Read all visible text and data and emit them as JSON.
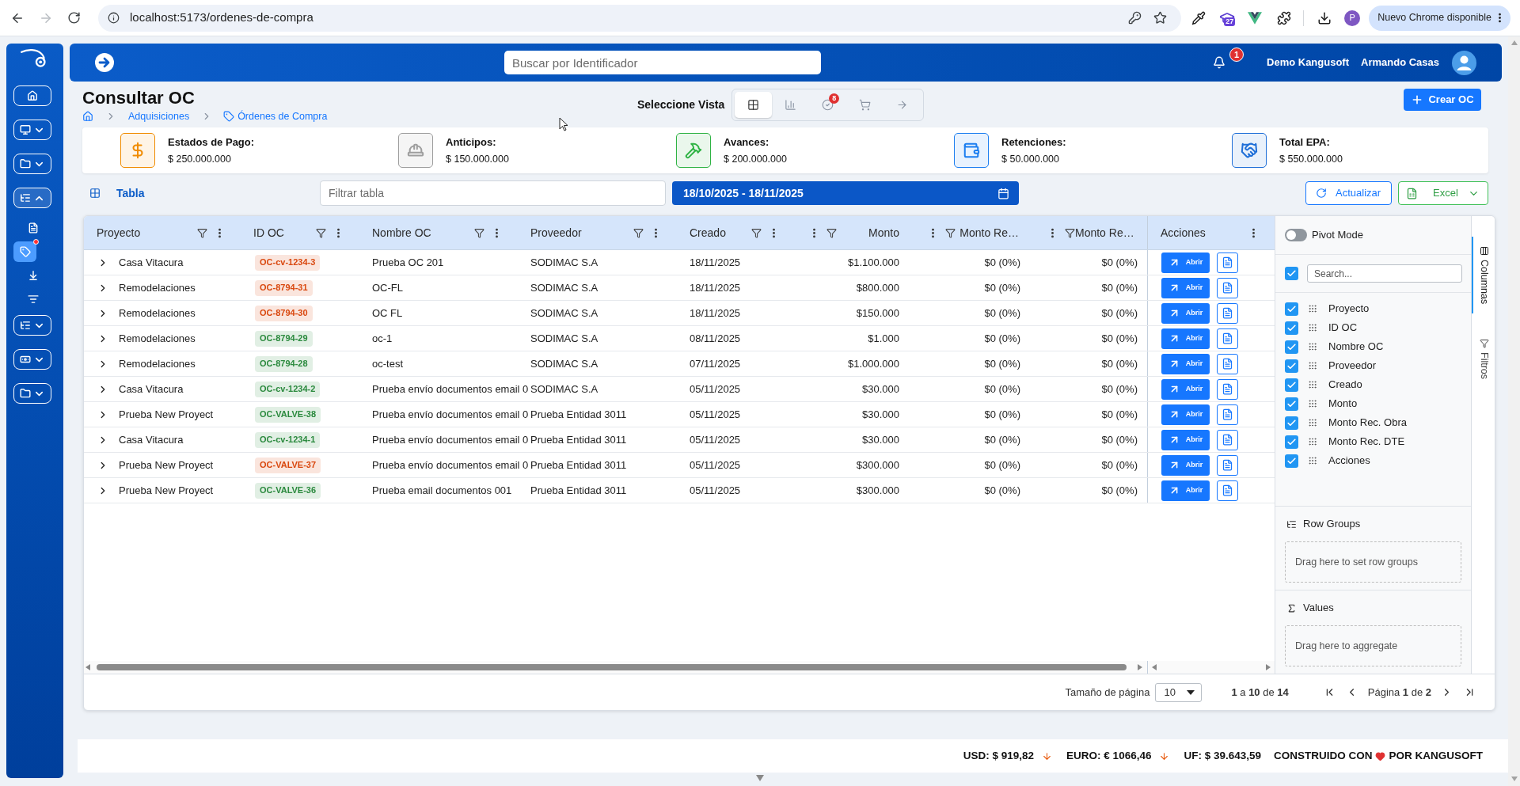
{
  "browser": {
    "forward_disabled": true,
    "url": "localhost:5173/ordenes-de-compra",
    "extension_badge": "27",
    "profile_initial": "P",
    "update_button": "Nuevo Chrome disponible"
  },
  "sidebar": {
    "items": [
      {
        "kind": "button"
      },
      {
        "kind": "dropdown",
        "expanded": false
      },
      {
        "kind": "dropdown",
        "expanded": false
      },
      {
        "kind": "dropdown",
        "expanded": true,
        "children": [
          {
            "selected": false,
            "notification": false
          },
          {
            "selected": true,
            "notification": true
          },
          {
            "selected": false,
            "notification": false
          },
          {
            "selected": false,
            "notification": false
          }
        ]
      },
      {
        "kind": "dropdown",
        "expanded": false
      },
      {
        "kind": "dropdown",
        "expanded": false
      },
      {
        "kind": "dropdown",
        "expanded": false
      }
    ]
  },
  "header": {
    "search": {
      "placeholder": "Buscar por Identificador"
    },
    "notification_count": "1",
    "company": "Demo Kangusoft",
    "user": "Armando Casas"
  },
  "page": {
    "title": "Consultar OC",
    "breadcrumbs": [
      "Adquisiciones",
      "Órdenes de Compra"
    ],
    "view_selector": {
      "label": "Seleccione Vista",
      "views": [
        {
          "selected": true
        },
        {
          "selected": false
        },
        {
          "selected": false,
          "badge": "8"
        },
        {
          "selected": false
        },
        {
          "selected": false
        }
      ]
    },
    "create_button": "Crear OC"
  },
  "summary_cards": [
    {
      "title": "Estados de Pago:",
      "value": "$ 250.000.000",
      "color": "#f08c00"
    },
    {
      "title": "Anticipos:",
      "value": "$ 150.000.000",
      "color": "#9e9e9e"
    },
    {
      "title": "Avances:",
      "value": "$ 200.000.000",
      "color": "#2fb344"
    },
    {
      "title": "Retenciones:",
      "value": "$ 50.000.000",
      "color": "#1c7ef0"
    },
    {
      "title": "Total EPA:",
      "value": "$ 550.000.000",
      "color": "#1f6fd8"
    }
  ],
  "toolbar": {
    "view_label": "Tabla",
    "filter": {
      "placeholder": "Filtrar tabla"
    },
    "date_range": "18/10/2025 - 18/11/2025",
    "refresh_button": "Actualizar",
    "export_button": "Excel"
  },
  "table": {
    "columns": [
      {
        "label": "Proyecto",
        "kind": "text",
        "filterable": true
      },
      {
        "label": "ID OC",
        "kind": "text",
        "filterable": true
      },
      {
        "label": "Nombre OC",
        "kind": "text",
        "filterable": true
      },
      {
        "label": "Proveedor",
        "kind": "text",
        "filterable": true
      },
      {
        "label": "Creado",
        "kind": "text",
        "filterable": true
      },
      {
        "label": "Monto",
        "kind": "number",
        "filterable": true
      },
      {
        "label": "Monto Re…",
        "kind": "number",
        "filterable": true
      },
      {
        "label": "Monto Re…",
        "kind": "number",
        "filterable": true
      },
      {
        "label": "Acciones",
        "kind": "actions",
        "filterable": false
      }
    ],
    "rows": [
      {
        "expanded": false,
        "project": "Casa Vitacura",
        "id": {
          "text": "OC-cv-1234-3",
          "color": "#d9480f"
        },
        "name": "Prueba OC 201",
        "supplier": "SODIMAC S.A",
        "created": "18/11/2025",
        "amount": "$1.100.000",
        "monto_rec_obra": "$0 (0%)",
        "monto_rec_dte": "$0 (0%)",
        "action": "Abrir"
      },
      {
        "expanded": false,
        "project": "Remodelaciones",
        "id": {
          "text": "OC-8794-31",
          "color": "#d9480f"
        },
        "name": "OC-FL",
        "supplier": "SODIMAC S.A",
        "created": "18/11/2025",
        "amount": "$800.000",
        "monto_rec_obra": "$0 (0%)",
        "monto_rec_dte": "$0 (0%)",
        "action": "Abrir"
      },
      {
        "expanded": false,
        "project": "Remodelaciones",
        "id": {
          "text": "OC-8794-30",
          "color": "#d9480f"
        },
        "name": "OC FL",
        "supplier": "SODIMAC S.A",
        "created": "18/11/2025",
        "amount": "$150.000",
        "monto_rec_obra": "$0 (0%)",
        "monto_rec_dte": "$0 (0%)",
        "action": "Abrir"
      },
      {
        "expanded": false,
        "project": "Remodelaciones",
        "id": {
          "text": "OC-8794-29",
          "color": "#2b8a3e"
        },
        "name": "oc-1",
        "supplier": "SODIMAC S.A",
        "created": "08/11/2025",
        "amount": "$1.000",
        "monto_rec_obra": "$0 (0%)",
        "monto_rec_dte": "$0 (0%)",
        "action": "Abrir"
      },
      {
        "expanded": false,
        "project": "Remodelaciones",
        "id": {
          "text": "OC-8794-28",
          "color": "#2b8a3e"
        },
        "name": "oc-test",
        "supplier": "SODIMAC S.A",
        "created": "07/11/2025",
        "amount": "$1.000.000",
        "monto_rec_obra": "$0 (0%)",
        "monto_rec_dte": "$0 (0%)",
        "action": "Abrir"
      },
      {
        "expanded": false,
        "project": "Casa Vitacura",
        "id": {
          "text": "OC-cv-1234-2",
          "color": "#2b8a3e"
        },
        "name": "Prueba envío documentos email 0",
        "supplier": "SODIMAC S.A",
        "created": "05/11/2025",
        "amount": "$30.000",
        "monto_rec_obra": "$0 (0%)",
        "monto_rec_dte": "$0 (0%)",
        "action": "Abrir"
      },
      {
        "expanded": false,
        "project": "Prueba New Proyect",
        "id": {
          "text": "OC-VALVE-38",
          "color": "#2b8a3e"
        },
        "name": "Prueba envío documentos email 0",
        "supplier": "Prueba Entidad 3011",
        "created": "05/11/2025",
        "amount": "$30.000",
        "monto_rec_obra": "$0 (0%)",
        "monto_rec_dte": "$0 (0%)",
        "action": "Abrir"
      },
      {
        "expanded": false,
        "project": "Casa Vitacura",
        "id": {
          "text": "OC-cv-1234-1",
          "color": "#2b8a3e"
        },
        "name": "Prueba envío documentos email 0",
        "supplier": "Prueba Entidad 3011",
        "created": "05/11/2025",
        "amount": "$30.000",
        "monto_rec_obra": "$0 (0%)",
        "monto_rec_dte": "$0 (0%)",
        "action": "Abrir"
      },
      {
        "expanded": false,
        "project": "Prueba New Proyect",
        "id": {
          "text": "OC-VALVE-37",
          "color": "#d9480f"
        },
        "name": "Prueba envío documentos email 0",
        "supplier": "Prueba Entidad 3011",
        "created": "05/11/2025",
        "amount": "$300.000",
        "monto_rec_obra": "$0 (0%)",
        "monto_rec_dte": "$0 (0%)",
        "action": "Abrir"
      },
      {
        "expanded": false,
        "project": "Prueba New Proyect",
        "id": {
          "text": "OC-VALVE-36",
          "color": "#2b8a3e"
        },
        "name": "Prueba email documentos 001",
        "supplier": "Prueba Entidad 3011",
        "created": "05/11/2025",
        "amount": "$300.000",
        "monto_rec_obra": "$0 (0%)",
        "monto_rec_dte": "$0 (0%)",
        "action": "Abrir"
      }
    ],
    "side_panel": {
      "pivot_mode": {
        "label": "Pivot Mode",
        "on": false
      },
      "select_all_checked": true,
      "search": {
        "placeholder": "Search..."
      },
      "columns": [
        {
          "label": "Proyecto",
          "checked": true
        },
        {
          "label": "ID OC",
          "checked": true
        },
        {
          "label": "Nombre OC",
          "checked": true
        },
        {
          "label": "Proveedor",
          "checked": true
        },
        {
          "label": "Creado",
          "checked": true
        },
        {
          "label": "Monto",
          "checked": true
        },
        {
          "label": "Monto Rec. Obra",
          "checked": true
        },
        {
          "label": "Monto Rec. DTE",
          "checked": true
        },
        {
          "label": "Acciones",
          "checked": true
        }
      ],
      "row_groups": {
        "title": "Row Groups",
        "hint": "Drag here to set row groups"
      },
      "values": {
        "title": "Values",
        "hint": "Drag here to aggregate"
      },
      "tabs": [
        {
          "label": "Columnas",
          "selected": true
        },
        {
          "label": "Filtros",
          "selected": false
        }
      ]
    },
    "pagination": {
      "page_size_label": "Tamaño de página",
      "page_size": "10",
      "range": "**1** a **10** de **14**",
      "page": "Página **1** de **2**"
    }
  },
  "footer": {
    "rates": [
      {
        "label": "USD: $ 919,82",
        "falling": true
      },
      {
        "label": "EURO: € 1066,46",
        "falling": true
      },
      {
        "label": "UF: $ 39.643,59",
        "falling": false
      }
    ],
    "credit_prefix": "CONSTRUIDO CON",
    "credit_suffix": "POR KANGUSOFT"
  }
}
